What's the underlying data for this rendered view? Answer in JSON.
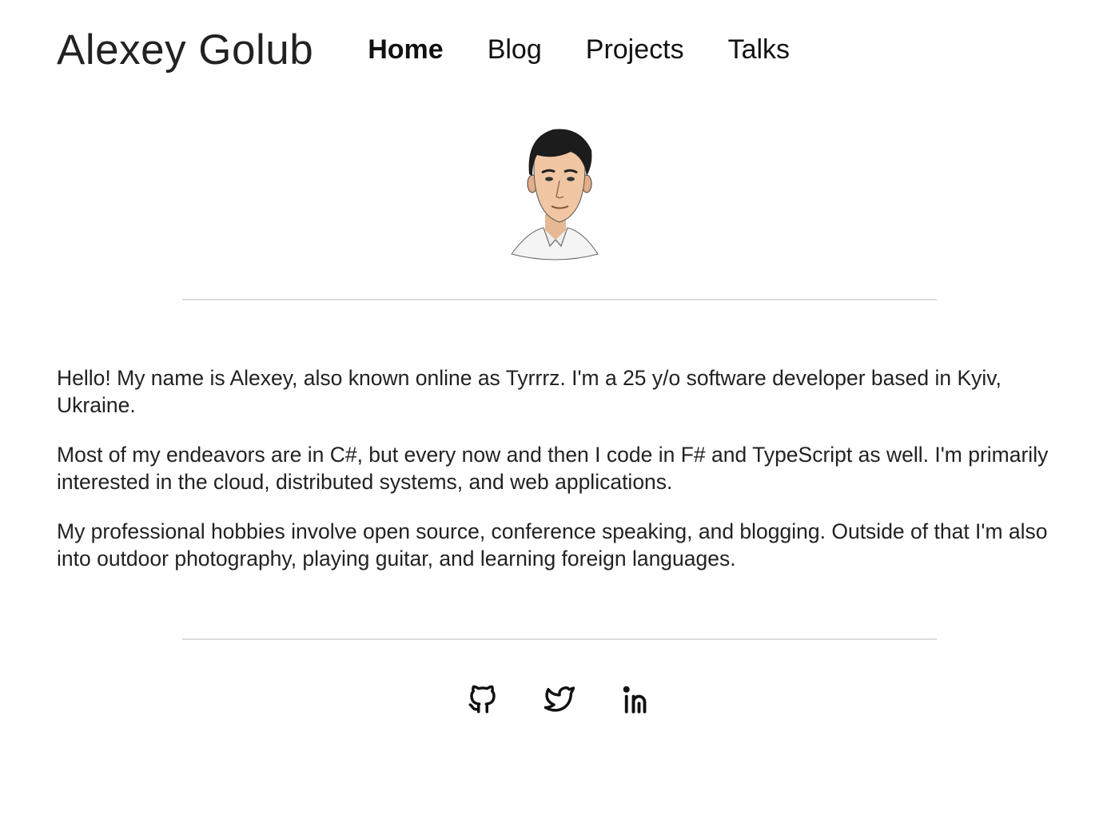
{
  "header": {
    "title": "Alexey Golub",
    "nav": [
      {
        "label": "Home",
        "active": true
      },
      {
        "label": "Blog",
        "active": false
      },
      {
        "label": "Projects",
        "active": false
      },
      {
        "label": "Talks",
        "active": false
      }
    ]
  },
  "avatar": {
    "icon": "cartoon-portrait"
  },
  "bio": {
    "paragraphs": [
      "Hello! My name is Alexey, also known online as Tyrrrz. I'm a 25 y/o software developer based in Kyiv, Ukraine.",
      "Most of my endeavors are in C#, but every now and then I code in F# and TypeScript as well. I'm primarily interested in the cloud, distributed systems, and web applications.",
      "My professional hobbies involve open source, conference speaking, and blogging. Outside of that I'm also into outdoor photography, playing guitar, and learning foreign languages."
    ]
  },
  "social": [
    {
      "icon": "github-icon"
    },
    {
      "icon": "twitter-icon"
    },
    {
      "icon": "linkedin-icon"
    }
  ],
  "colors": {
    "text": "#222222",
    "divider": "#dcdcdc",
    "background": "#ffffff"
  }
}
